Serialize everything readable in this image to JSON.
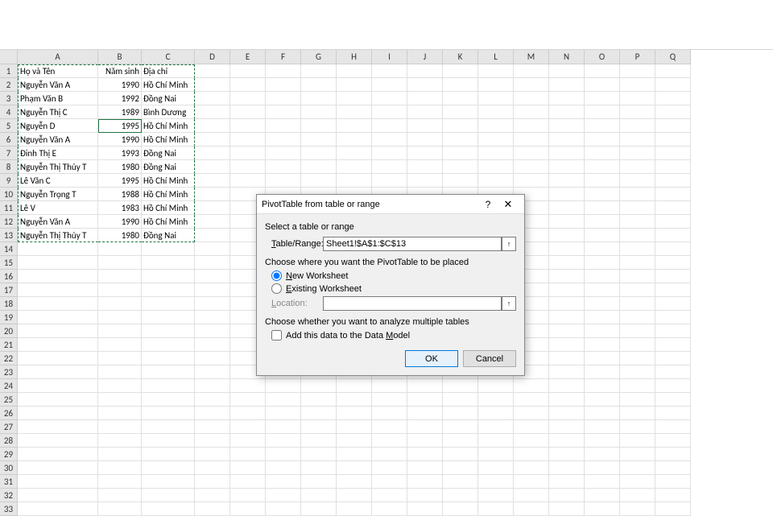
{
  "columns": [
    "A",
    "B",
    "C",
    "D",
    "E",
    "F",
    "G",
    "H",
    "I",
    "J",
    "K",
    "L",
    "M",
    "N",
    "O",
    "P",
    "Q"
  ],
  "colWidths": {
    "A": 100,
    "B": 54,
    "C": 66
  },
  "totalRows": 33,
  "table": {
    "headers": [
      "Họ và Tên",
      "Năm sinh",
      "Địa chỉ"
    ],
    "rows": [
      [
        "Nguyễn Văn A",
        "1990",
        "Hồ Chí Minh"
      ],
      [
        "Phạm Văn B",
        "1992",
        "Đồng Nai"
      ],
      [
        "Nguyễn Thị C",
        "1989",
        "Bình Dương"
      ],
      [
        "Nguyễn D",
        "1995",
        "Hồ Chí Minh"
      ],
      [
        "Nguyễn Văn A",
        "1990",
        "Hồ Chí Minh"
      ],
      [
        "Đinh Thị E",
        "1993",
        "Đồng Nai"
      ],
      [
        "Nguyễn Thị Thủy T",
        "1980",
        "Đồng Nai"
      ],
      [
        "Lê Văn C",
        "1995",
        "Hồ Chí Minh"
      ],
      [
        "Nguyễn Trọng T",
        "1988",
        "Hồ Chí Minh"
      ],
      [
        "Lê V",
        "1983",
        "Hồ Chí Minh"
      ],
      [
        "Nguyễn Văn A",
        "1990",
        "Hồ Chí Minh"
      ],
      [
        "Nguyễn Thị Thủy T",
        "1980",
        "Đồng Nai"
      ]
    ]
  },
  "activeCell": {
    "row": 5,
    "col": "B"
  },
  "selection": {
    "range": "A1:C13",
    "marching": true
  },
  "dialog": {
    "title": "PivotTable from table or range",
    "help": "?",
    "close": "✕",
    "section1": "Select a table or range",
    "tableRangeLabel": "Table/Range:",
    "tableRangeValue": "Sheet1!$A$1:$C$13",
    "section2": "Choose where you want the PivotTable to be placed",
    "newWorksheet": "New Worksheet",
    "existingWorksheet": "Existing Worksheet",
    "locationLabel": "Location:",
    "locationValue": "",
    "section3": "Choose whether you want to analyze multiple tables",
    "addDataModel": "Add this data to the Data Model",
    "ok": "OK",
    "cancel": "Cancel",
    "placement": "new",
    "addModelChecked": false
  }
}
